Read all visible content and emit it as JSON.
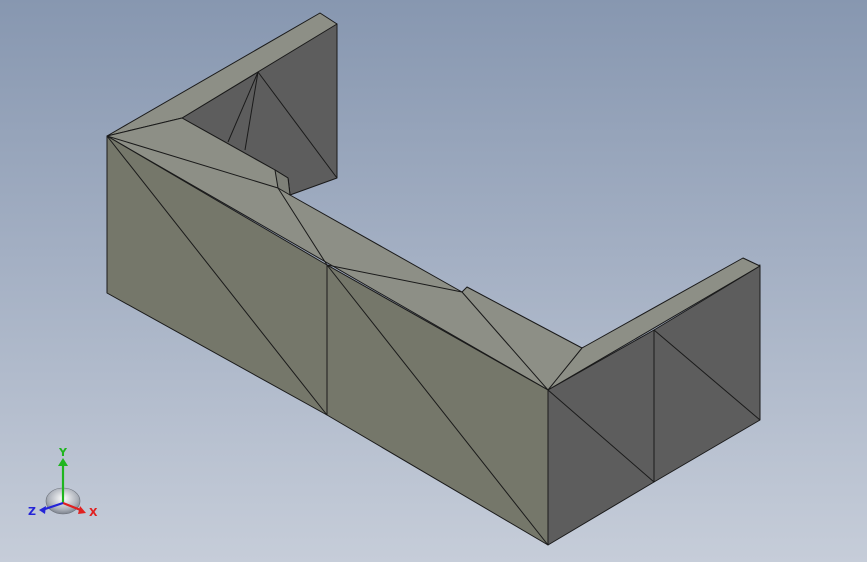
{
  "viewport": {
    "background_top": "#8797b0",
    "background_bottom": "#c6cdd9"
  },
  "model": {
    "shape": "u-shaped-channel",
    "tessellated": true,
    "face_colors": {
      "top": "#8d8f86",
      "front": "#75776a",
      "side": "#5d5d5d",
      "edge": "#1a1a1a"
    }
  },
  "triad": {
    "x_label": "X",
    "y_label": "Y",
    "z_label": "Z",
    "x_color": "#e02020",
    "y_color": "#1fb51f",
    "z_color": "#2424d8"
  }
}
